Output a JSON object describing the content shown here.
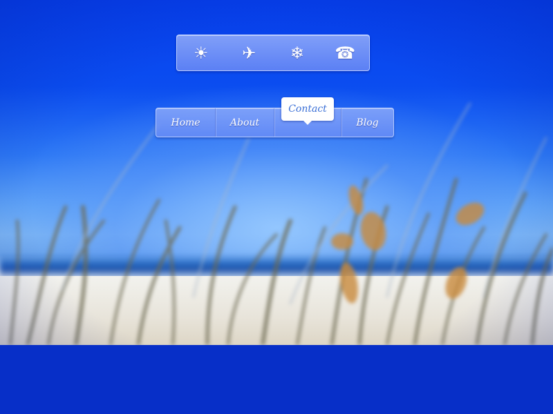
{
  "icon_bar": {
    "items": [
      {
        "name": "sun",
        "glyph": "☀"
      },
      {
        "name": "airplane",
        "glyph": "✈"
      },
      {
        "name": "snowflake",
        "glyph": "❄"
      },
      {
        "name": "telephone",
        "glyph": "☎"
      }
    ]
  },
  "nav": {
    "items": [
      {
        "label": "Home"
      },
      {
        "label": "About"
      },
      {
        "label": "Contact"
      },
      {
        "label": "Blog"
      }
    ],
    "active_index": 2
  },
  "colors": {
    "sky": "#0a3fe6",
    "bar_tint": "#7e9df5",
    "tooltip_text": "#3a6fd6",
    "label": "#ffffff"
  }
}
